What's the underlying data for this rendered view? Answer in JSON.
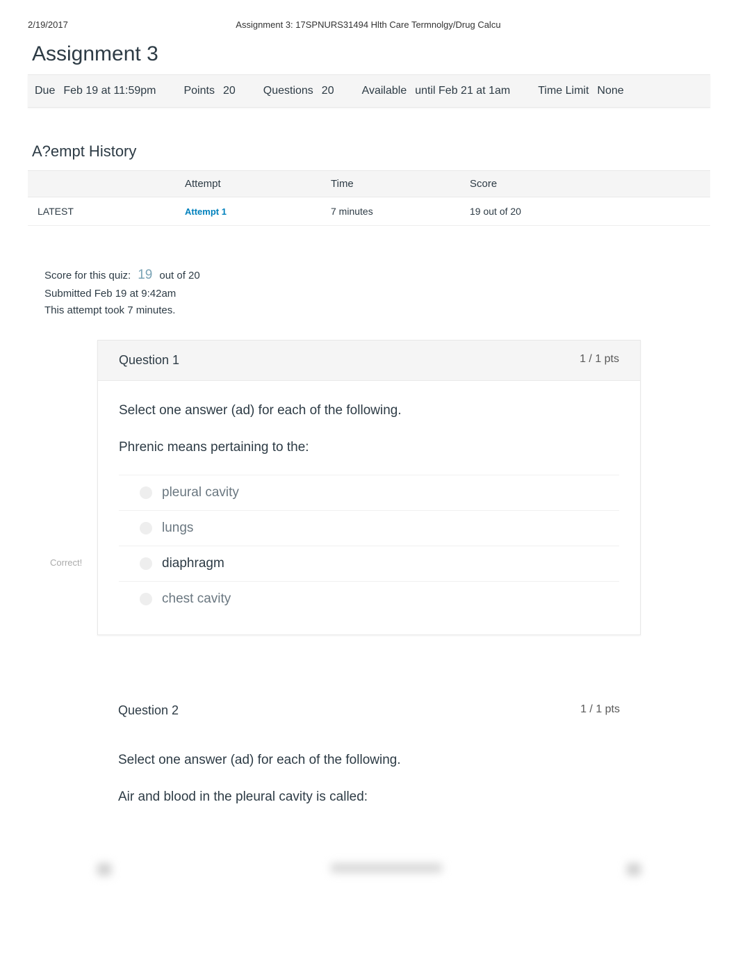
{
  "header": {
    "date": "2/19/2017",
    "course_title": "Assignment 3: 17SPNURS31494 Hlth Care Termnolgy/Drug Calcu"
  },
  "assignment": {
    "title": "Assignment 3",
    "due_label": "Due",
    "due_value": "Feb 19 at 11:59pm",
    "points_label": "Points",
    "points_value": "20",
    "questions_label": "Questions",
    "questions_value": "20",
    "available_label": "Available",
    "available_value": "until Feb 21 at 1am",
    "timelimit_label": "Time Limit",
    "timelimit_value": "None"
  },
  "attempt_history": {
    "title": "A?empt History",
    "columns": {
      "status": "",
      "attempt": "Attempt",
      "time": "Time",
      "score": "Score"
    },
    "rows": [
      {
        "status": "LATEST",
        "attempt": "Attempt 1",
        "time": "7 minutes",
        "score": "19 out of 20"
      }
    ]
  },
  "summary": {
    "score_label": "Score for this quiz:",
    "score_value": "19",
    "score_suffix": "out of 20",
    "submitted": "Submitted Feb 19 at 9:42am",
    "duration": "This attempt took 7 minutes."
  },
  "questions": [
    {
      "number": "Question 1",
      "pts": "1 / 1 pts",
      "prompt": "Select one answer (ad) for each of the following.",
      "text": "Phrenic means pertaining to the:",
      "correct_tag": "Correct!",
      "answers": [
        {
          "label": "pleural cavity",
          "correct": false
        },
        {
          "label": "lungs",
          "correct": false
        },
        {
          "label": "diaphragm",
          "correct": true
        },
        {
          "label": "chest cavity",
          "correct": false
        }
      ]
    },
    {
      "number": "Question 2",
      "pts": "1 / 1 pts",
      "prompt": "Select one answer (ad) for each of the following.",
      "text": "Air and blood in the pleural cavity is called:"
    }
  ]
}
